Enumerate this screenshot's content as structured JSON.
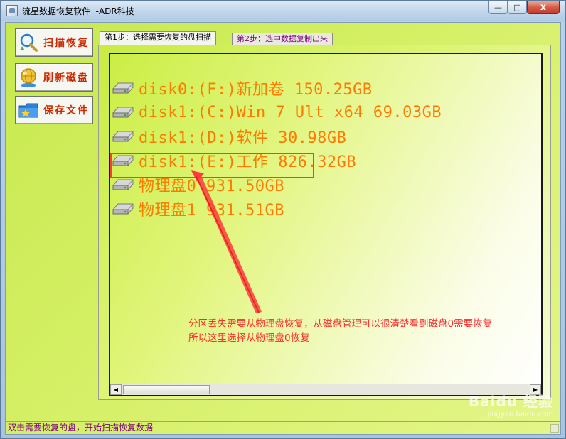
{
  "window": {
    "title": "流星数据恢复软件  -ADR科技",
    "minimize_symbol": "—",
    "maximize_symbol": "□",
    "close_symbol": "x"
  },
  "sidebar": {
    "buttons": [
      {
        "label": "扫描恢复",
        "icon": "magnifier-icon"
      },
      {
        "label": "刷新磁盘",
        "icon": "globe-icon"
      },
      {
        "label": "保存文件",
        "icon": "folder-star-icon"
      }
    ]
  },
  "tabs": [
    {
      "label": "第1步：选择需要恢复的盘扫描",
      "active": true
    },
    {
      "label": "第2步：选中数据复制出来",
      "active": false
    }
  ],
  "disks": [
    {
      "label": "disk0:(F:)新加卷 150.25GB"
    },
    {
      "label": "disk1:(C:)Win 7 Ult x64 69.03GB"
    },
    {
      "label": "disk1:(D:)软件 30.98GB"
    },
    {
      "label": "disk1:(E:)工作 826.32GB"
    },
    {
      "label": "物理盘0 931.50GB"
    },
    {
      "label": "物理盘1 931.51GB"
    }
  ],
  "annotation": {
    "line1": "分区丢失需要从物理盘恢复，从磁盘管理可以很清楚看到磁盘0需要恢复",
    "line2": "所以这里选择从物理盘0恢复"
  },
  "scrollbar": {
    "left_arrow": "◀",
    "right_arrow": "▶"
  },
  "status_bar": {
    "text": "双击需要恢复的盘，开始扫描恢复数据"
  },
  "watermark": {
    "text": "Baidu 经验",
    "sub": "jingyan.baidu.com"
  },
  "colors": {
    "list_text": "#ff7a00",
    "annotation": "#ff2a2a",
    "button_label": "#cc2a00",
    "client_bg": "#d4ef63"
  }
}
